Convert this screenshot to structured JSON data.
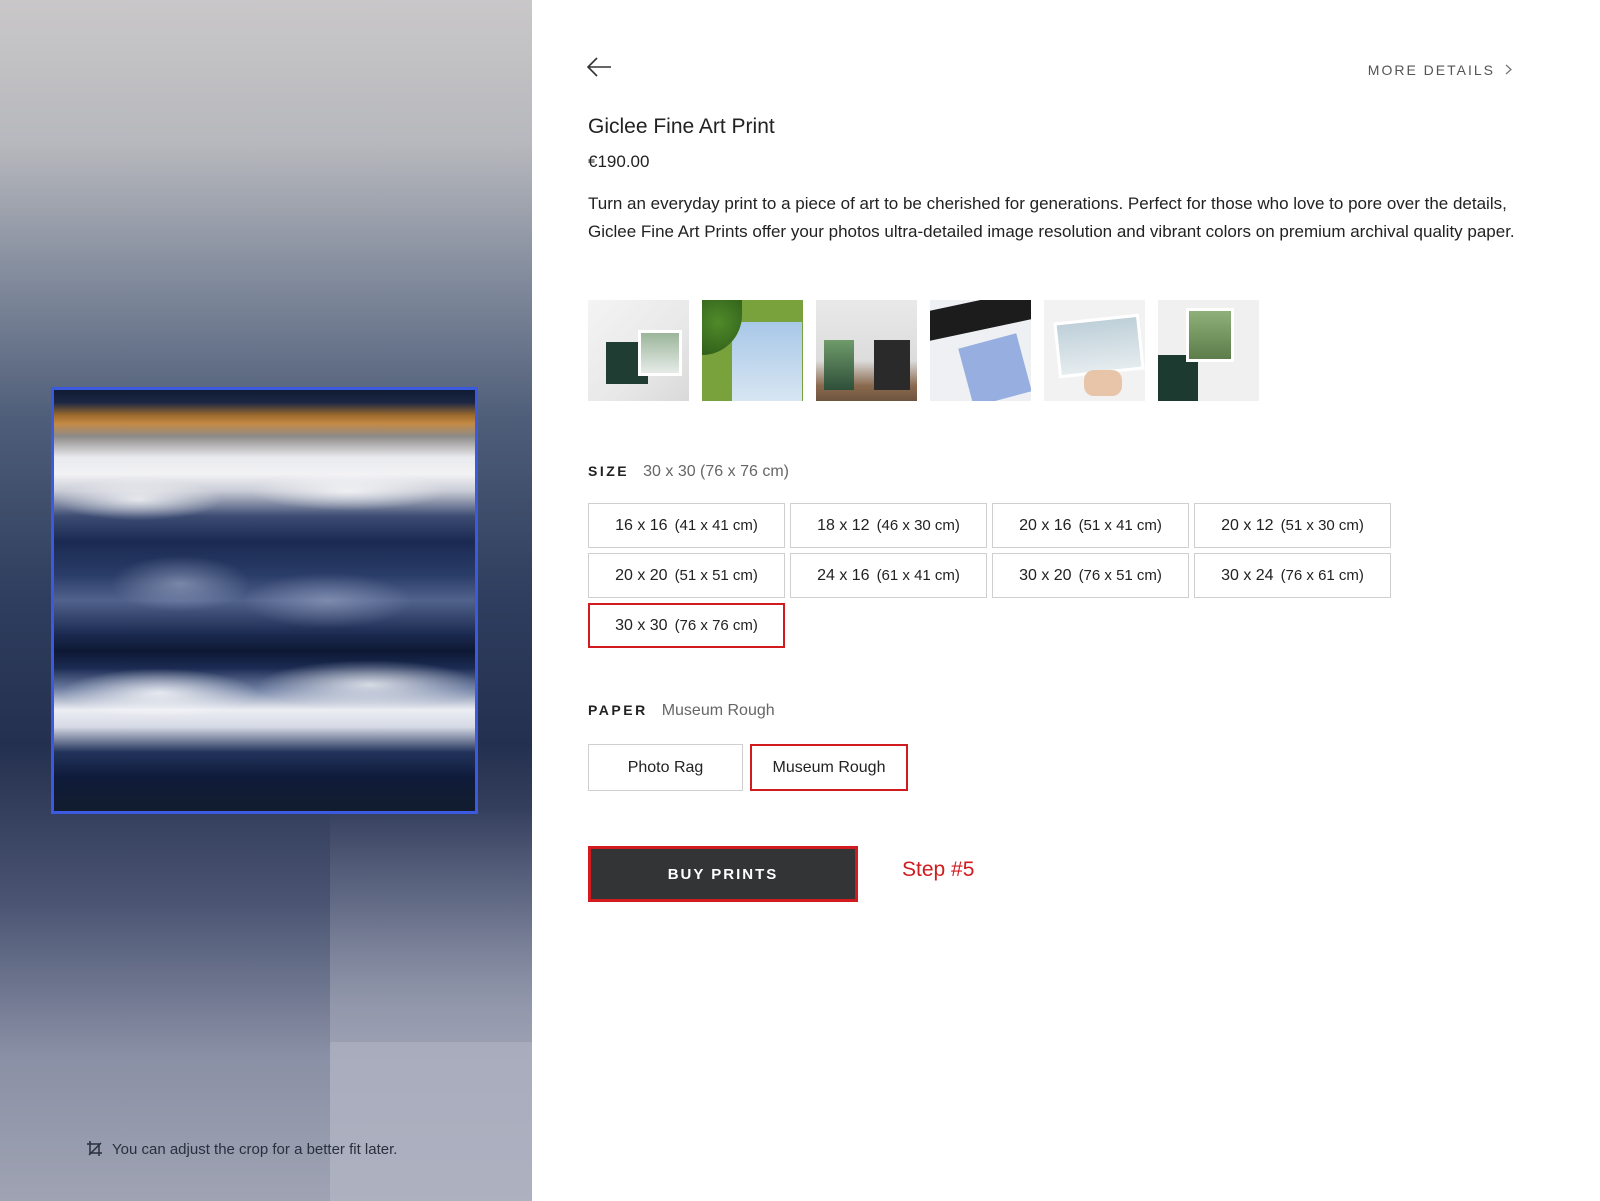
{
  "preview": {
    "crop_hint": "You can adjust the crop for a better fit later.",
    "icons": {
      "crop": "crop-icon"
    }
  },
  "header": {
    "back_icon": "back-arrow-icon",
    "more_details_label": "MORE DETAILS",
    "more_details_icon": "chevron-right-icon"
  },
  "product": {
    "title": "Giclee Fine Art Print",
    "price": "€190.00",
    "description": "Turn an everyday print to a piece of art to be cherished for generations. Perfect for those who love to pore over the details, Giclee Fine Art Prints offer your photos ultra-detailed image resolution and vibrant colors on premium archival quality paper."
  },
  "size": {
    "label": "SIZE",
    "selected_value": "30 x 30 (76 x 76 cm)",
    "options": [
      {
        "inch": "16 x 16",
        "cm": "(41 x 41 cm)"
      },
      {
        "inch": "18 x 12",
        "cm": "(46 x 30 cm)"
      },
      {
        "inch": "20 x 16",
        "cm": "(51 x 41 cm)"
      },
      {
        "inch": "20 x 12",
        "cm": "(51 x 30 cm)"
      },
      {
        "inch": "20 x 20",
        "cm": "(51 x 51 cm)"
      },
      {
        "inch": "24 x 16",
        "cm": "(61 x 41 cm)"
      },
      {
        "inch": "30 x 20",
        "cm": "(76 x 51 cm)"
      },
      {
        "inch": "30 x 24",
        "cm": "(76 x 61 cm)"
      },
      {
        "inch": "30 x 30",
        "cm": "(76 x 76 cm)"
      }
    ]
  },
  "paper": {
    "label": "PAPER",
    "selected_value": "Museum Rough",
    "options": [
      "Photo Rag",
      "Museum Rough"
    ]
  },
  "actions": {
    "buy_label": "BUY PRINTS"
  },
  "annotation": {
    "step": "Step #5"
  },
  "colors": {
    "highlight": "#d11b1f",
    "frame": "#3c5ae0",
    "button_bg": "#333436"
  }
}
